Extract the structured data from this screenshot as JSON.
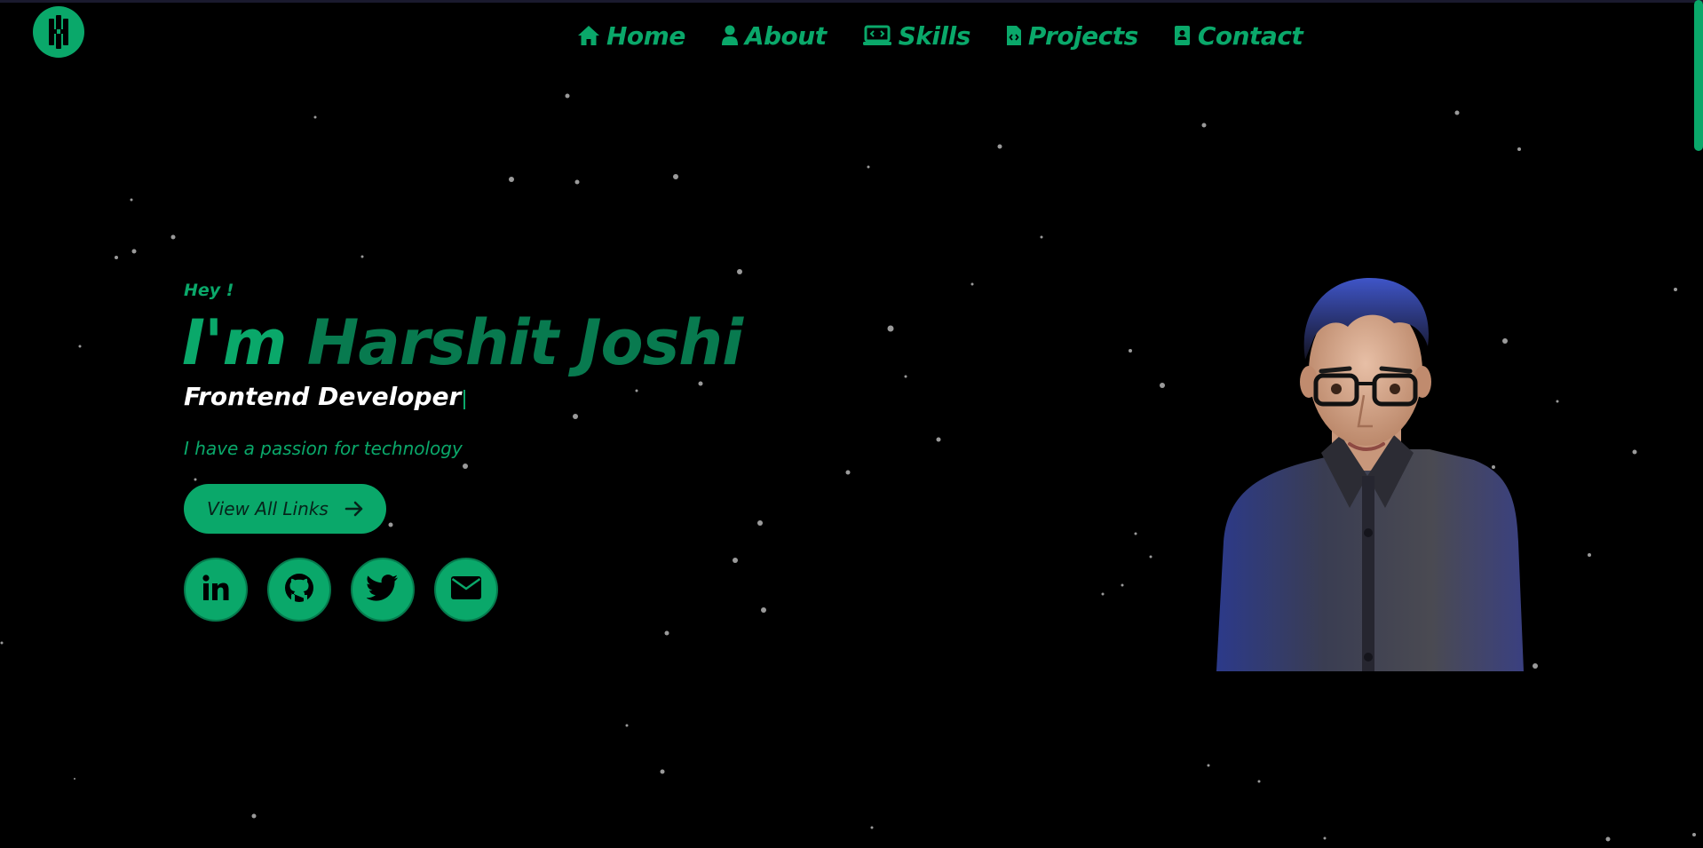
{
  "logo": {
    "letter": "H"
  },
  "nav": {
    "items": [
      {
        "label": "Home",
        "icon": "home-icon"
      },
      {
        "label": "About",
        "icon": "user-icon"
      },
      {
        "label": "Skills",
        "icon": "laptop-code-icon"
      },
      {
        "label": "Projects",
        "icon": "file-code-icon"
      },
      {
        "label": "Contact",
        "icon": "address-book-icon"
      }
    ]
  },
  "hero": {
    "greeting": "Hey !",
    "im": "I'm",
    "name": "Harshit Joshi",
    "role": "Frontend Developer",
    "tagline": "I have a passion for technology",
    "cta_label": "View All Links"
  },
  "socials": [
    {
      "name": "linkedin-icon"
    },
    {
      "name": "github-icon"
    },
    {
      "name": "twitter-icon"
    },
    {
      "name": "envelope-icon"
    }
  ],
  "colors": {
    "accent": "#0aa86a",
    "accent_dark": "#087a4f",
    "background": "#000000",
    "role_text": "#ffffff"
  }
}
